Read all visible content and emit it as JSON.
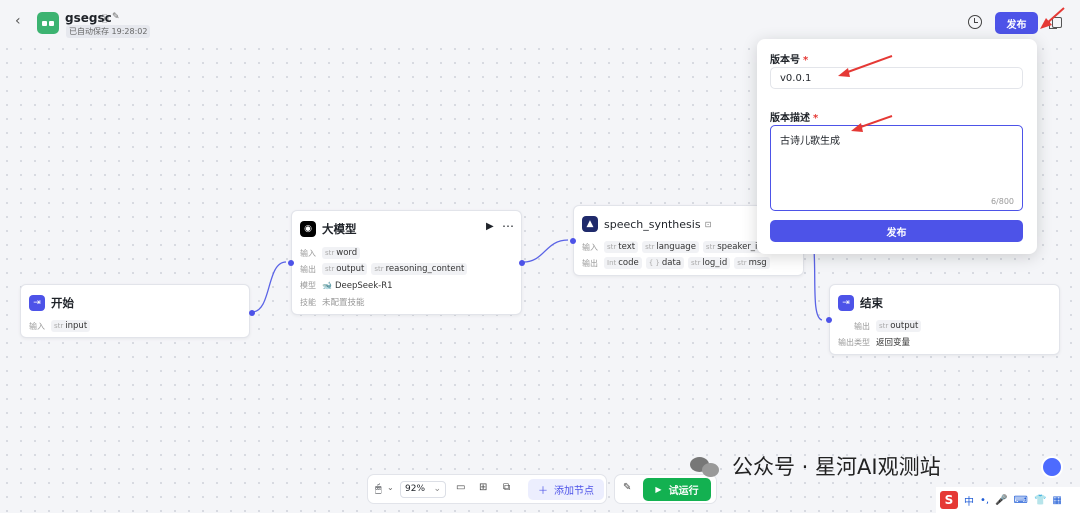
{
  "topbar": {
    "back_icon": "chevron-left-icon",
    "app_name": "gsegsc",
    "autosave_label": "已自动保存 19:28:02",
    "publish_label": "发布"
  },
  "nodes": {
    "start": {
      "title": "开始",
      "input_label": "输入",
      "input_var": "input"
    },
    "llm": {
      "title": "大模型",
      "input_label": "输入",
      "input_var": "word",
      "output_label": "输出",
      "output_var_1": "output",
      "output_var_2": "reasoning_content",
      "model_label": "模型",
      "model_value": "DeepSeek-R1",
      "skill_label": "技能",
      "skill_value": "未配置技能"
    },
    "speech": {
      "title": "speech_synthesis",
      "input_label": "输入",
      "in_1": "text",
      "in_2": "language",
      "in_3": "speaker_id",
      "output_label": "输出",
      "out_1": "code",
      "out_2": "data",
      "out_3": "log_id",
      "out_4": "msg"
    },
    "end": {
      "title": "结束",
      "output_label": "输出",
      "output_var": "output",
      "output_type_label": "输出类型",
      "output_type_value": "返回变量"
    }
  },
  "type_tags": {
    "str": "str",
    "int": "Int",
    "obj": "{ }"
  },
  "toolbar": {
    "zoom": "92%",
    "add_node_label": "添加节点",
    "run_label": "试运行"
  },
  "popover": {
    "version_label": "版本号",
    "version_value": "v0.0.1",
    "desc_label": "版本描述",
    "desc_value": "古诗儿歌生成",
    "desc_count": "6/800",
    "submit_label": "发布"
  },
  "watermark": "公众号 · 星河AI观测站",
  "tray": {
    "ime_label": "中"
  },
  "colors": {
    "accent": "#4d53e8",
    "start_node": "#4d53e8",
    "app_logo": "#3cb371",
    "run_button": "#13b151",
    "annotation_arrow": "#e53935"
  }
}
